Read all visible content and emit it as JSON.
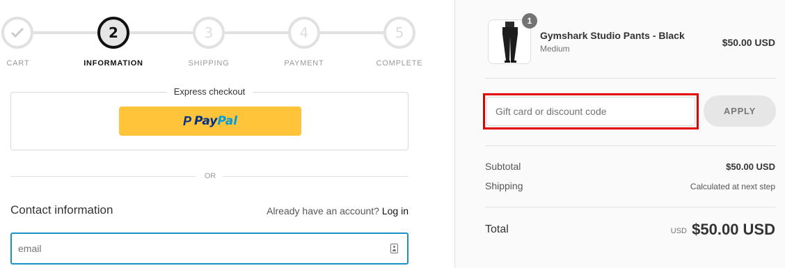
{
  "steps": [
    {
      "number": "✓",
      "label": "CART",
      "state": "done"
    },
    {
      "number": "2",
      "label": "INFORMATION",
      "state": "active"
    },
    {
      "number": "3",
      "label": "SHIPPING",
      "state": "pending"
    },
    {
      "number": "4",
      "label": "PAYMENT",
      "state": "pending"
    },
    {
      "number": "5",
      "label": "COMPLETE",
      "state": "pending"
    }
  ],
  "express": {
    "title": "Express checkout",
    "paypal_icon": "paypal-icon",
    "paypal_logo_p": "P",
    "paypal_logo_pay": "Pay",
    "paypal_logo_pal": "Pal"
  },
  "divider_or": "OR",
  "contact": {
    "title": "Contact information",
    "account_prompt": "Already have an account?",
    "login_label": "Log in",
    "email_placeholder": "email",
    "email_value": ""
  },
  "summary": {
    "item": {
      "quantity": "1",
      "name": "Gymshark Studio Pants - Black",
      "variant": "Medium",
      "price": "$50.00 USD"
    },
    "discount": {
      "placeholder": "Gift card or discount code",
      "apply_label": "APPLY"
    },
    "subtotal_label": "Subtotal",
    "subtotal_value": "$50.00 USD",
    "shipping_label": "Shipping",
    "shipping_value": "Calculated at next step",
    "total_label": "Total",
    "total_currency": "USD",
    "total_value": "$50.00 USD"
  },
  "colors": {
    "accent_focus": "#1990c6",
    "paypal_yellow": "#ffc439",
    "highlight_red": "#e00000"
  }
}
